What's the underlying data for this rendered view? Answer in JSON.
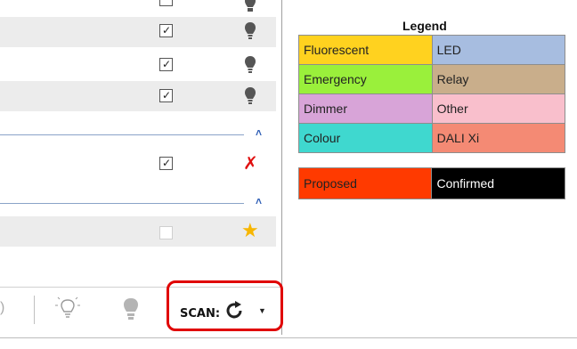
{
  "legend": {
    "title": "Legend",
    "rows": [
      [
        {
          "label": "Fluorescent",
          "color": "#ffd21f"
        },
        {
          "label": "LED",
          "color": "#a7bde0"
        }
      ],
      [
        {
          "label": "Emergency",
          "color": "#9af03b"
        },
        {
          "label": "Relay",
          "color": "#c9ae8b"
        }
      ],
      [
        {
          "label": "Dimmer",
          "color": "#d8a4d8"
        },
        {
          "label": "Other",
          "color": "#f9bfcc"
        }
      ],
      [
        {
          "label": "Colour",
          "color": "#3fd8cf"
        },
        {
          "label": "DALI Xi",
          "color": "#f48a74"
        }
      ]
    ],
    "status": [
      {
        "label": "Proposed",
        "color": "#ff3a00",
        "text_color": "#222222"
      },
      {
        "label": "Confirmed",
        "color": "#000000",
        "text_color": "#ffffff"
      }
    ]
  },
  "list": {
    "rows": [
      {
        "checked": true,
        "icon": "bulb-icon"
      },
      {
        "checked": true,
        "icon": "bulb-icon"
      },
      {
        "checked": true,
        "icon": "bulb-icon"
      },
      {
        "checked": true,
        "icon": "dali-x-icon"
      },
      {
        "checked": false,
        "icon": "star-icon"
      }
    ],
    "collapse_icon": "chevron-up-icon"
  },
  "toolbar": {
    "scan_label": "SCAN:",
    "icons": [
      "partial-icon",
      "bulb-outline-icon",
      "bulb-filled-icon",
      "refresh-icon",
      "dropdown-arrow-icon"
    ]
  },
  "colors": {
    "highlight_border": "#e00000",
    "group_caret": "#2d5db5"
  }
}
